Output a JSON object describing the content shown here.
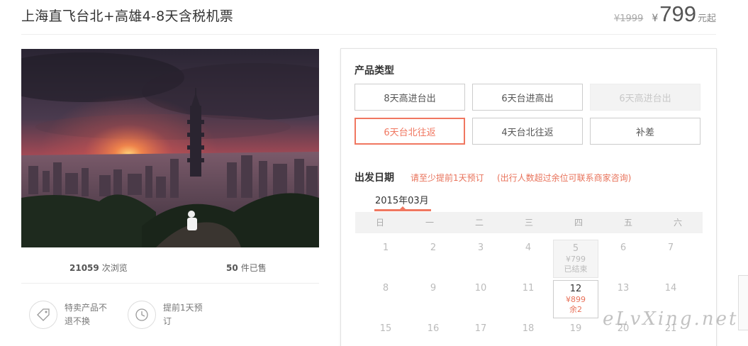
{
  "header": {
    "title": "上海直飞台北+高雄4-8天含税机票",
    "old_price": "¥1999",
    "currency": "¥",
    "price": "799",
    "price_suffix": "元起"
  },
  "stats": {
    "views_count": "21059",
    "views_label": "次浏览",
    "sold_count": "50",
    "sold_label": "件已售"
  },
  "features": [
    {
      "icon": "tag-icon",
      "text": "特卖产品不退不换"
    },
    {
      "icon": "clock-icon",
      "text": "提前1天预订"
    }
  ],
  "booking": {
    "product_type_label": "产品类型",
    "options": [
      {
        "label": "8天高进台出",
        "state": "normal"
      },
      {
        "label": "6天台进高出",
        "state": "normal"
      },
      {
        "label": "6天高进台出",
        "state": "disabled"
      },
      {
        "label": "6天台北往返",
        "state": "selected"
      },
      {
        "label": "4天台北往返",
        "state": "normal"
      },
      {
        "label": "补差",
        "state": "normal"
      }
    ],
    "date_label": "出发日期",
    "hint1": "请至少提前1天预订",
    "hint2": "(出行人数超过余位可联系商家咨询)",
    "month": "2015年03月",
    "weekdays": [
      "日",
      "一",
      "二",
      "三",
      "四",
      "五",
      "六"
    ],
    "week1": [
      "1",
      "2",
      "3",
      "4",
      "",
      "6",
      "7"
    ],
    "day5": {
      "num": "5",
      "price": "¥799",
      "status": "已结束"
    },
    "week2": [
      "8",
      "9",
      "10",
      "11",
      "",
      "13",
      "14"
    ],
    "day12": {
      "num": "12",
      "price": "¥899",
      "status": "余2"
    },
    "week3": [
      "15",
      "16",
      "17",
      "18",
      "19",
      "20",
      "21"
    ]
  },
  "watermark": "eLvXing.net",
  "colors": {
    "accent": "#f07760",
    "accent_text": "#e8725a"
  }
}
